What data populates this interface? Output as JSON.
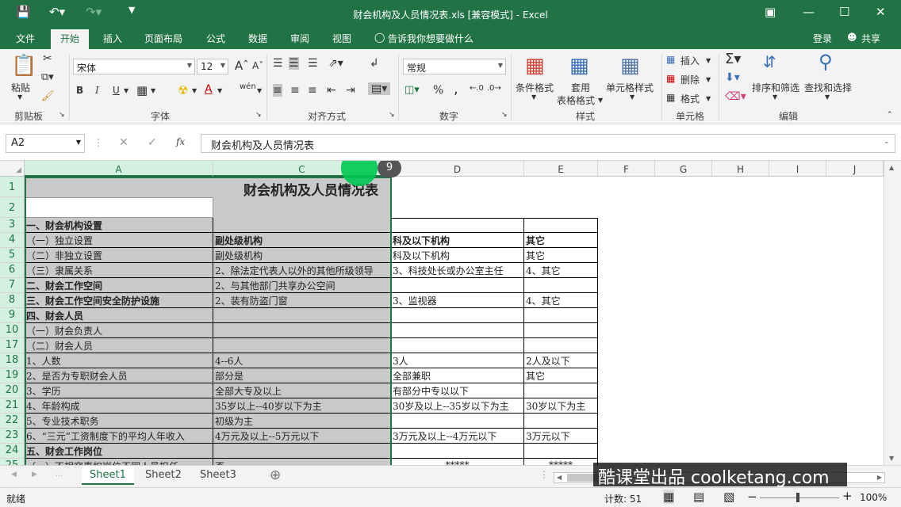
{
  "titlebar": {
    "title": "财会机构及人员情况表.xls  [兼容模式] - Excel",
    "icons": [
      "save-icon",
      "undo-icon",
      "redo-icon",
      "customize-icon"
    ],
    "window_icons": [
      "ribbon-display-icon",
      "minimize-icon",
      "maximize-icon",
      "close-icon"
    ]
  },
  "tabs": {
    "file": "文件",
    "home": "开始",
    "insert": "插入",
    "layout": "页面布局",
    "formulas": "公式",
    "data": "数据",
    "review": "审阅",
    "view": "视图",
    "tell": "告诉我你想要做什么",
    "login": "登录",
    "share": "共享"
  },
  "ribbon": {
    "paste": "粘贴",
    "font_name": "宋体",
    "font_size": "12",
    "bold": "B",
    "italic": "I",
    "underline": "U",
    "wen": "wén",
    "number_format": "常规",
    "percent": "%",
    "comma": ",",
    "cond_format": "条件格式",
    "table_format_1": "套用",
    "table_format_2": "表格格式",
    "cell_style": "单元格样式",
    "insert": "插入",
    "delete": "删除",
    "format": "格式",
    "sort_filter": "排序和筛选",
    "find_select": "查找和选择",
    "groups": {
      "clipboard": "剪贴板",
      "font": "字体",
      "alignment": "对齐方式",
      "number": "数字",
      "styles": "样式",
      "cells": "单元格",
      "editing": "编辑"
    }
  },
  "formula_bar": {
    "name_box": "A2",
    "content": "财会机构及人员情况表",
    "fx": "fx"
  },
  "columns": [
    "A",
    "C",
    "D",
    "E",
    "F",
    "G",
    "H",
    "I",
    "J"
  ],
  "rows": [
    "1",
    "2",
    "3",
    "4",
    "5",
    "6",
    "7",
    "8",
    "9",
    "10",
    "17",
    "18",
    "19",
    "20",
    "21",
    "22",
    "23",
    "24",
    "25"
  ],
  "indicator": "9",
  "sheet": {
    "title": "财会机构及人员情况表",
    "r3": {
      "a": "一、财会机构设置"
    },
    "r4": {
      "a": "（一）独立设置",
      "c": "副处级机构",
      "d": "科及以下机构",
      "e": "其它"
    },
    "r5": {
      "a": "（二）非独立设置",
      "c": "副处级机构",
      "d": "科及以下机构",
      "e": "其它"
    },
    "r6": {
      "a": "（三）隶属关系",
      "c": "2、除法定代表人以外的其他所级领导",
      "d": "3、科技处长或办公室主任",
      "e": "4、其它"
    },
    "r7": {
      "a": "二、财会工作空间",
      "c": "2、与其他部门共享办公空间"
    },
    "r8": {
      "a": "三、财会工作空间安全防护设施",
      "c": "2、装有防盗门窗",
      "d": "3、监视器",
      "e": "4、其它"
    },
    "r9": {
      "a": "四、财会人员"
    },
    "r10": {
      "a": "（一）财会负责人"
    },
    "r17": {
      "a": "（二）财会人员"
    },
    "r18": {
      "a": "1、人数",
      "c": "4--6人",
      "d": "3人",
      "e": "2人及以下"
    },
    "r19": {
      "a": "2、是否为专职财会人员",
      "c": "部分是",
      "d": "全部兼职",
      "e": "其它"
    },
    "r20": {
      "a": "3、学历",
      "c": "全部大专及以上",
      "d": "有部分中专以以下"
    },
    "r21": {
      "a": "4、年龄构成",
      "c": "35岁以上--40岁以下为主",
      "d": "30岁及以上--35岁以下为主",
      "e": "30岁以下为主"
    },
    "r22": {
      "a": "5、专业技术职务",
      "c": "初级为主"
    },
    "r23": {
      "a": "6、“三元”工资制度下的平均人年收入",
      "c": "4万元及以上--5万元以下",
      "d": "3万元及以上--4万元以下",
      "e": "3万元以下"
    },
    "r24": {
      "a": "五、财会工作岗位"
    },
    "r25": {
      "a": "（一）不相容事权岗位不同人员担任",
      "c": "否",
      "d": "*****",
      "e": "*****"
    }
  },
  "sheet_tabs": [
    "Sheet1",
    "Sheet2",
    "Sheet3"
  ],
  "status": {
    "ready": "就绪",
    "count": "计数: 51",
    "zoom": "100%",
    "minus": "−",
    "plus": "+"
  },
  "watermark": "酷课堂出品 coolketang.com",
  "colors": {
    "excel_green": "#217346",
    "selection_fill": "#c9c9c9",
    "indicator": "#00c853"
  }
}
